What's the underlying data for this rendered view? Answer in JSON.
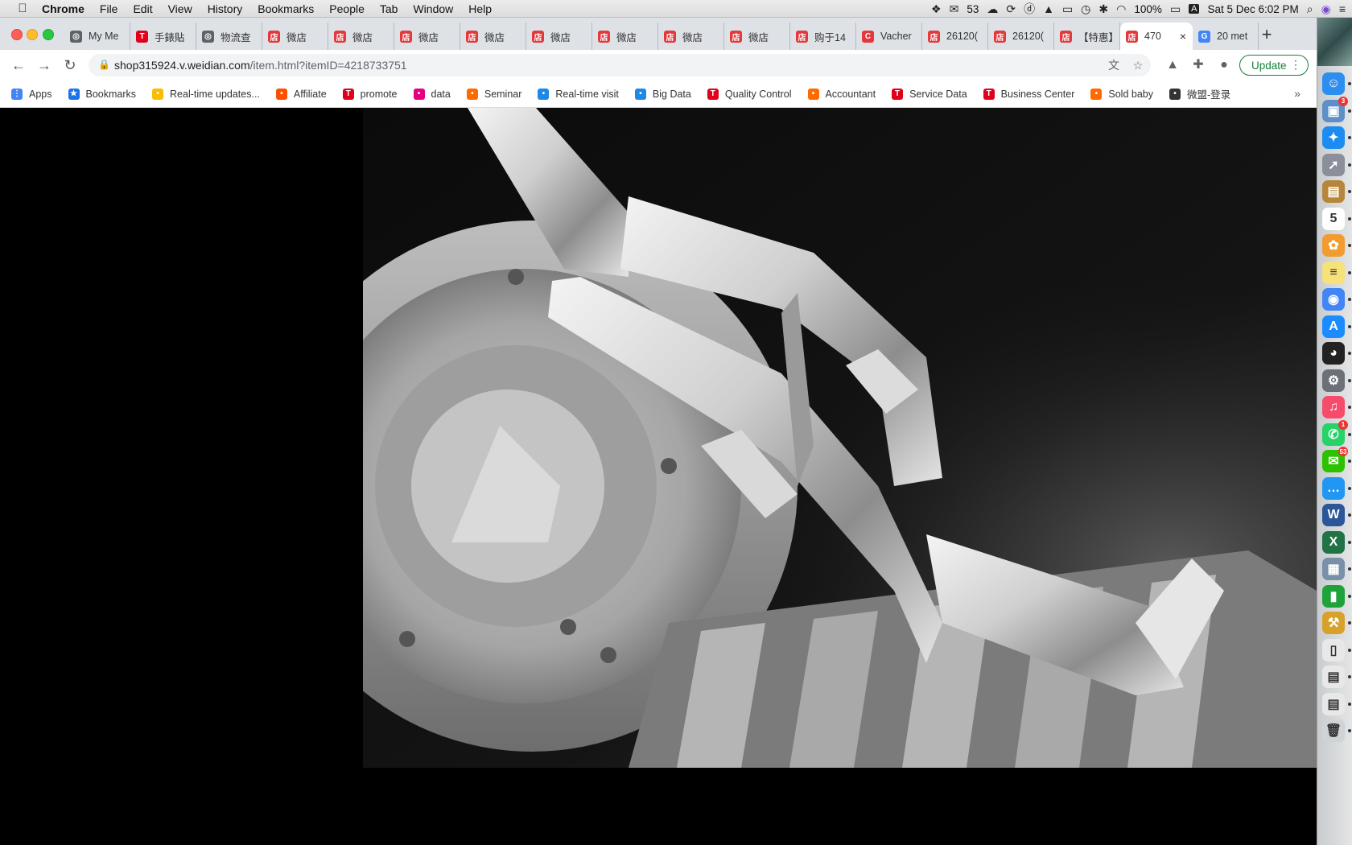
{
  "menubar": {
    "app_name": "Chrome",
    "menus": [
      "File",
      "Edit",
      "View",
      "History",
      "Bookmarks",
      "People",
      "Tab",
      "Window",
      "Help"
    ],
    "status": {
      "wechat_count": "53",
      "battery": "100%",
      "input_source": "A",
      "datetime": "Sat 5 Dec  6:02 PM"
    }
  },
  "tabs": [
    {
      "title": "My Me",
      "favicon": "refresh-icon",
      "color": "#5f6368"
    },
    {
      "title": "手錶貼",
      "favicon": "tmall-icon",
      "color": "#e0001b"
    },
    {
      "title": "物流查",
      "favicon": "globe-icon",
      "color": "#5f6368"
    },
    {
      "title": "微店",
      "favicon": "weidian-icon",
      "color": "#e4393c"
    },
    {
      "title": "微店",
      "favicon": "weidian-icon",
      "color": "#e4393c"
    },
    {
      "title": "微店",
      "favicon": "weidian-icon",
      "color": "#e4393c"
    },
    {
      "title": "微店",
      "favicon": "weidian-icon",
      "color": "#e4393c"
    },
    {
      "title": "微店",
      "favicon": "weidian-icon",
      "color": "#e4393c"
    },
    {
      "title": "微店",
      "favicon": "weidian-icon",
      "color": "#e4393c"
    },
    {
      "title": "微店",
      "favicon": "weidian-icon",
      "color": "#e4393c"
    },
    {
      "title": "微店",
      "favicon": "weidian-icon",
      "color": "#e4393c"
    },
    {
      "title": "购于14",
      "favicon": "weidian-icon",
      "color": "#e4393c"
    },
    {
      "title": "Vacher",
      "favicon": "vacheron-icon",
      "color": "#e4393c"
    },
    {
      "title": "26120(",
      "favicon": "weidian-icon",
      "color": "#e4393c"
    },
    {
      "title": "26120(",
      "favicon": "weidian-icon",
      "color": "#e4393c"
    },
    {
      "title": "【特惠】",
      "favicon": "weidian-icon",
      "color": "#e4393c"
    },
    {
      "title": "470",
      "favicon": "weidian-icon",
      "color": "#e4393c",
      "active": true
    },
    {
      "title": "20 met",
      "favicon": "google-icon",
      "color": "#4285f4"
    }
  ],
  "toolbar": {
    "url_host": "shop315924.v.weidian.com",
    "url_path": "/item.html?itemID=4218733751",
    "update_label": "Update"
  },
  "bookmarks": [
    {
      "label": "Apps",
      "icon": "apps-grid-icon",
      "color": "#4285f4"
    },
    {
      "label": "Bookmarks",
      "icon": "star-icon",
      "color": "#1a73e8"
    },
    {
      "label": "Real-time updates...",
      "icon": "chrome-icon",
      "color": "#fbbc05"
    },
    {
      "label": "Affiliate",
      "icon": "affiliate-icon",
      "color": "#ff5000"
    },
    {
      "label": "promote",
      "icon": "tmall-icon",
      "color": "#e0001b"
    },
    {
      "label": "data",
      "icon": "data-icon",
      "color": "#e4007f"
    },
    {
      "label": "Seminar",
      "icon": "seminar-icon",
      "color": "#ff6a00"
    },
    {
      "label": "Real-time visit",
      "icon": "visit-icon",
      "color": "#1e88e5"
    },
    {
      "label": "Big Data",
      "icon": "bigdata-icon",
      "color": "#1e88e5"
    },
    {
      "label": "Quality Control",
      "icon": "tmall-icon",
      "color": "#e0001b"
    },
    {
      "label": "Accountant",
      "icon": "accountant-icon",
      "color": "#ff6a00"
    },
    {
      "label": "Service Data",
      "icon": "tmall-icon",
      "color": "#e0001b"
    },
    {
      "label": "Business Center",
      "icon": "tmall-icon",
      "color": "#e0001b"
    },
    {
      "label": "Sold baby",
      "icon": "soldbaby-icon",
      "color": "#ff6a00"
    },
    {
      "label": "微盟-登录",
      "icon": "weimob-icon",
      "color": "#333333"
    }
  ],
  "dock": [
    {
      "name": "finder-icon",
      "color": "#2e8ef0",
      "glyph": "☺"
    },
    {
      "name": "preview-icon",
      "color": "#5e8fc8",
      "glyph": "▣",
      "badge": "3"
    },
    {
      "name": "safari-icon",
      "color": "#1d8cf0",
      "glyph": "✦"
    },
    {
      "name": "launchpad-icon",
      "color": "#8a8f99",
      "glyph": "➚"
    },
    {
      "name": "notes-book-icon",
      "color": "#b8863b",
      "glyph": "▤"
    },
    {
      "name": "calendar-icon",
      "color": "#ffffff",
      "glyph": "5"
    },
    {
      "name": "photos-icon",
      "color": "#f29b2e",
      "glyph": "✿"
    },
    {
      "name": "notes-icon",
      "color": "#f7e27a",
      "glyph": "≡"
    },
    {
      "name": "chrome-icon",
      "color": "#4285f4",
      "glyph": "◉"
    },
    {
      "name": "app-store-icon",
      "color": "#1a8cff",
      "glyph": "A"
    },
    {
      "name": "qq-icon",
      "color": "#222222",
      "glyph": "◕"
    },
    {
      "name": "system-preferences-icon",
      "color": "#6c7078",
      "glyph": "⚙"
    },
    {
      "name": "music-icon",
      "color": "#f74b6b",
      "glyph": "♫"
    },
    {
      "name": "whatsapp-icon",
      "color": "#25d366",
      "glyph": "✆",
      "badge": "1"
    },
    {
      "name": "wechat-icon",
      "color": "#2dc100",
      "glyph": "✉",
      "badge": "53"
    },
    {
      "name": "messages-icon",
      "color": "#2196f3",
      "glyph": "…"
    },
    {
      "name": "word-icon",
      "color": "#2b579a",
      "glyph": "W"
    },
    {
      "name": "excel-icon",
      "color": "#217346",
      "glyph": "X"
    },
    {
      "name": "image-capture-icon",
      "color": "#7a8fa8",
      "glyph": "▦"
    },
    {
      "name": "numbers-icon",
      "color": "#1ea33a",
      "glyph": "▮"
    },
    {
      "name": "utility-icon",
      "color": "#d8a12b",
      "glyph": "⚒"
    },
    {
      "name": "document-icon",
      "color": "#e8e8e8",
      "glyph": "▯"
    },
    {
      "name": "spreadsheet-doc-icon",
      "color": "#e8e8e8",
      "glyph": "▤"
    },
    {
      "name": "spreadsheet-doc-icon-2",
      "color": "#e8e8e8",
      "glyph": "▤"
    },
    {
      "name": "trash-icon",
      "color": "#cfd3d6",
      "glyph": "🗑"
    }
  ]
}
